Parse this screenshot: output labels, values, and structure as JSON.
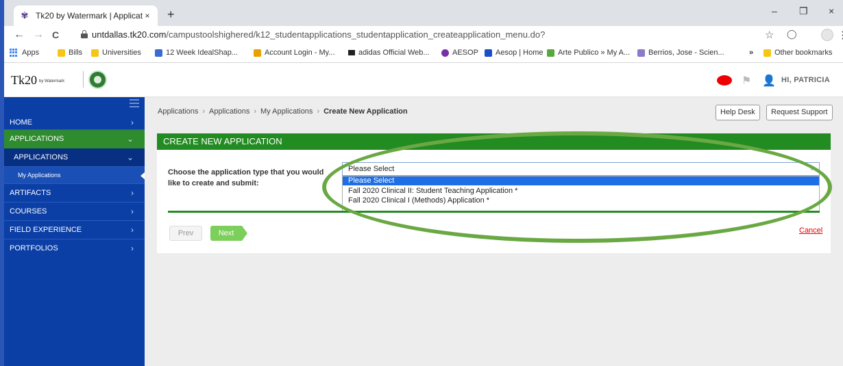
{
  "browser": {
    "tab_title": "Tk20 by Watermark | Application",
    "tab_close": "×",
    "new_tab": "+",
    "minimize": "–",
    "restore": "❐",
    "close": "×",
    "back": "←",
    "forward": "→",
    "reload": "C",
    "url_host": "untdallas.tk20.com",
    "url_path": "/campustoolshighered/k12_studentapplications_studentapplication_createapplication_menu.do?",
    "star": "☆",
    "extension": "◯",
    "menu": "⋮"
  },
  "bookmarks": {
    "items": [
      "Apps",
      "Bills",
      "Universities",
      "12 Week IdealShap...",
      "Account Login - My...",
      "adidas Official Web...",
      "AESOP",
      "Aesop | Home",
      "Arte Publico » My A...",
      "Berrios, Jose - Scien..."
    ],
    "more": "»",
    "other": "Other bookmarks"
  },
  "header": {
    "logo_main": "Tk20",
    "logo_sub": "by Watermark",
    "greeting": "HI, PATRICIA"
  },
  "sidebar": {
    "items": [
      {
        "label": "HOME",
        "chev": "›"
      },
      {
        "label": "APPLICATIONS",
        "chev": "⌄"
      },
      {
        "label": "APPLICATIONS",
        "chev": "⌄"
      },
      {
        "label": "My Applications",
        "chev": ""
      },
      {
        "label": "ARTIFACTS",
        "chev": "›"
      },
      {
        "label": "COURSES",
        "chev": "›"
      },
      {
        "label": "FIELD EXPERIENCE",
        "chev": "›"
      },
      {
        "label": "PORTFOLIOS",
        "chev": "›"
      }
    ]
  },
  "breadcrumb": {
    "items": [
      "Applications",
      "Applications",
      "My Applications"
    ],
    "current": "Create New Application",
    "sep": "›"
  },
  "actions": {
    "help_desk": "Help Desk",
    "request_support": "Request Support"
  },
  "panel": {
    "title": "CREATE NEW APPLICATION",
    "question": "Choose the application type that you would like to create and submit:",
    "select_value": "Please Select",
    "select_arrow": "⌄",
    "options": [
      "Please Select",
      "Fall 2020 Clinical II: Student Teaching Application *",
      "Fall 2020 Clinical I (Methods) Application *"
    ],
    "prev": "Prev",
    "next": "Next",
    "cancel": "Cancel"
  },
  "colors": {
    "sidebar": "#0b3fa6",
    "active": "#2e8b2e",
    "panel_header": "#228b22",
    "selected_option": "#1e6fe6",
    "annotation": "#6aa843"
  }
}
